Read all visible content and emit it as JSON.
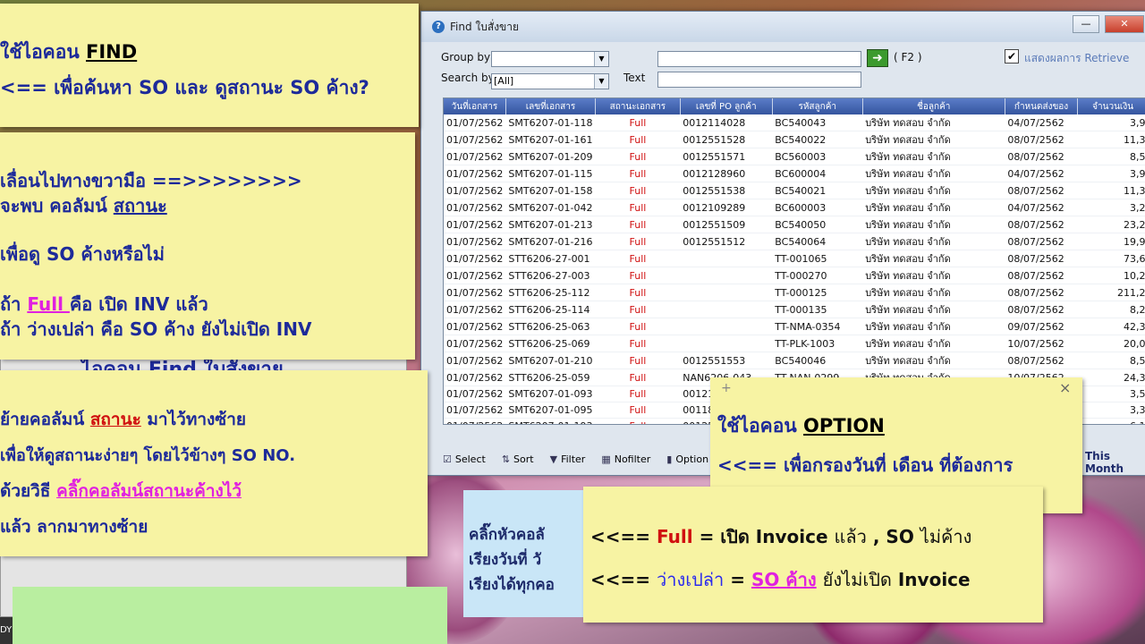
{
  "window": {
    "title": "Find ใบสั่งขาย",
    "controls": [
      "—",
      "❐",
      "✕"
    ]
  },
  "filters": {
    "group_by_label": "Group by",
    "search_by_label": "Search by",
    "search_by_value": "[All]",
    "text_label": "Text",
    "f2_label": "( F2 )",
    "retrieve_label": "แสดงผลการ Retrieve"
  },
  "grid": {
    "columns": [
      "วันที่เอกสาร",
      "เลขที่เอกสาร",
      "สถานะเอกสาร",
      "เลขที่ PO ลูกค้า",
      "รหัสลูกค้า",
      "ชื่อลูกค้า",
      "กำหนดส่งของ",
      "จำนวนเงิน"
    ],
    "rows": [
      [
        "01/07/2562",
        "SMT6207-01-118",
        "Full",
        "0012114028",
        "BC540043",
        "บริษัท ทดสอบ จำกัด",
        "04/07/2562",
        "3,9"
      ],
      [
        "01/07/2562",
        "SMT6207-01-161",
        "Full",
        "0012551528",
        "BC540022",
        "บริษัท ทดสอบ จำกัด",
        "08/07/2562",
        "11,3"
      ],
      [
        "01/07/2562",
        "SMT6207-01-209",
        "Full",
        "0012551571",
        "BC560003",
        "บริษัท ทดสอบ จำกัด",
        "08/07/2562",
        "8,5"
      ],
      [
        "01/07/2562",
        "SMT6207-01-115",
        "Full",
        "0012128960",
        "BC600004",
        "บริษัท ทดสอบ จำกัด",
        "04/07/2562",
        "3,9"
      ],
      [
        "01/07/2562",
        "SMT6207-01-158",
        "Full",
        "0012551538",
        "BC540021",
        "บริษัท ทดสอบ จำกัด",
        "08/07/2562",
        "11,3"
      ],
      [
        "01/07/2562",
        "SMT6207-01-042",
        "Full",
        "0012109289",
        "BC600003",
        "บริษัท ทดสอบ จำกัด",
        "04/07/2562",
        "3,2"
      ],
      [
        "01/07/2562",
        "SMT6207-01-213",
        "Full",
        "0012551509",
        "BC540050",
        "บริษัท ทดสอบ จำกัด",
        "08/07/2562",
        "23,2"
      ],
      [
        "01/07/2562",
        "SMT6207-01-216",
        "Full",
        "0012551512",
        "BC540064",
        "บริษัท ทดสอบ จำกัด",
        "08/07/2562",
        "19,9"
      ],
      [
        "01/07/2562",
        "STT6206-27-001",
        "Full",
        "",
        "TT-001065",
        "บริษัท ทดสอบ จำกัด",
        "08/07/2562",
        "73,6"
      ],
      [
        "01/07/2562",
        "STT6206-27-003",
        "Full",
        "",
        "TT-000270",
        "บริษัท ทดสอบ จำกัด",
        "08/07/2562",
        "10,2"
      ],
      [
        "01/07/2562",
        "STT6206-25-112",
        "Full",
        "",
        "TT-000125",
        "บริษัท ทดสอบ จำกัด",
        "08/07/2562",
        "211,2"
      ],
      [
        "01/07/2562",
        "STT6206-25-114",
        "Full",
        "",
        "TT-000135",
        "บริษัท ทดสอบ จำกัด",
        "08/07/2562",
        "8,2"
      ],
      [
        "01/07/2562",
        "STT6206-25-063",
        "Full",
        "",
        "TT-NMA-0354",
        "บริษัท ทดสอบ จำกัด",
        "09/07/2562",
        "42,3"
      ],
      [
        "01/07/2562",
        "STT6206-25-069",
        "Full",
        "",
        "TT-PLK-1003",
        "บริษัท ทดสอบ จำกัด",
        "10/07/2562",
        "20,0"
      ],
      [
        "01/07/2562",
        "SMT6207-01-210",
        "Full",
        "0012551553",
        "BC540046",
        "บริษัท ทดสอบ จำกัด",
        "08/07/2562",
        "8,5"
      ],
      [
        "01/07/2562",
        "STT6206-25-059",
        "Full",
        "NAN6206-043",
        "TT-NAN-0299",
        "บริษัท ทดสอบ จำกัด",
        "10/07/2562",
        "24,3"
      ],
      [
        "01/07/2562",
        "SMT6207-01-093",
        "Full",
        "001210",
        "",
        "",
        "",
        "3,5"
      ],
      [
        "01/07/2562",
        "SMT6207-01-095",
        "Full",
        "001181",
        "",
        "",
        "",
        "3,3"
      ],
      [
        "01/07/2562",
        "SMT6207-01-193",
        "Full",
        "001255",
        "",
        "",
        "",
        "6,1"
      ]
    ]
  },
  "toolbar": {
    "select": "Select",
    "sort": "Sort",
    "filter": "Filter",
    "nofilter": "Nofilter",
    "option": "Option",
    "this_month": "This Month"
  },
  "notes": {
    "n1": [
      "ใช้ไอคอน FIND",
      "<== เพื่อค้นหา SO และ ดูสถานะ SO ค้าง?"
    ],
    "n2": [
      "เลื่อนไปทางขวามือ ==>>>>>>>>",
      "จะพบ คอลัมน์ สถานะ",
      "เพื่อดู SO ค้างหรือไม่",
      "ถ้า Full  คือ เปิด INV แล้ว",
      "ถ้า ว่างเปล่า คือ SO ค้าง ยังไม่เปิด INV"
    ],
    "hidden_line": "ไอคอน Find ใบสั่งขาย",
    "n3": [
      "ย้ายคอลัมน์ สถานะ มาไว้ทางซ้าย",
      "เพื่อให้ดูสถานะง่ายๆ โดยไว้ข้างๆ SO NO.",
      "ด้วยวิธี คลิ๊กคอลัมน์สถานะค้างไว้",
      "แล้ว ลากมาทางซ้าย"
    ],
    "n4": [
      "ใช้ไอคอน OPTION",
      "<<== เพื่อกรองวันที่ เดือน ที่ต้องการ"
    ],
    "n5": [
      "<<== Full = เปิด Invoice แล้ว , SO ไม่ค้าง",
      "<<== ว่างเปล่า = SO ค้าง ยังไม่เปิด Invoice"
    ],
    "blue": [
      "คลิ๊กหัวคอลั",
      "เรียงวันที่  วั",
      "เรียงได้ทุกคอ"
    ],
    "corner": "DY",
    "plus": "+",
    "close": "×"
  },
  "colors": {
    "note_bg": "#f7f3a3",
    "note_text": "#1d2a9a",
    "status_red": "#d01010",
    "header_blue": "#35559e"
  }
}
